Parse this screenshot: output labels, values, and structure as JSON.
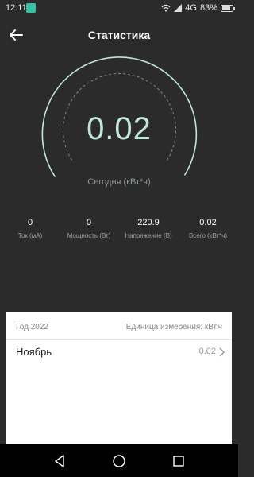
{
  "status": {
    "time": "12:11",
    "network": "4G",
    "battery": "83%"
  },
  "header": {
    "title": "Статистика"
  },
  "gauge": {
    "value": "0.02",
    "label": "Сегодня (кВт*ч)"
  },
  "stats": [
    {
      "value": "0",
      "label": "Ток (мА)"
    },
    {
      "value": "0",
      "label": "Мощность (Вт)"
    },
    {
      "value": "220.9",
      "label": "Напряжение (В)"
    },
    {
      "value": "0.02",
      "label": "Всего (кВт*ч)"
    }
  ],
  "panel": {
    "year": "Год 2022",
    "unit": "Единица измерения: кВт.ч",
    "rows": [
      {
        "month": "Ноябрь",
        "value": "0.02"
      }
    ]
  },
  "colors": {
    "background": "#2b2b2b",
    "gauge_arc": "#bfe8d6",
    "accent": "#35c3a3"
  }
}
